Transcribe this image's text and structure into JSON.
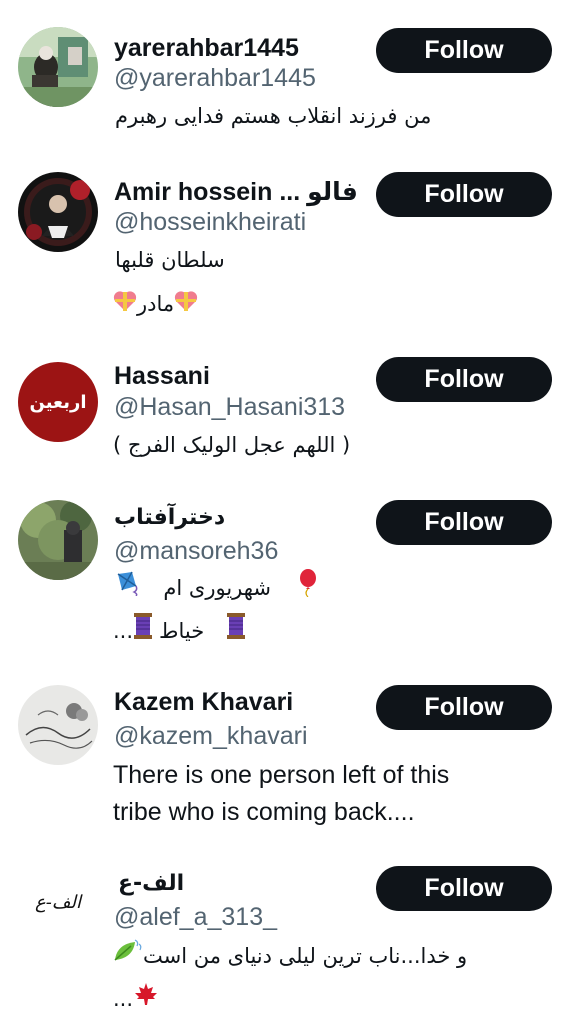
{
  "follow_label": "Follow",
  "users": [
    {
      "name": "yarerahbar1445",
      "handle": "@yarerahbar1445",
      "bio_lines": [
        "من فرزند انقلاب هستم فدایی رهبرم"
      ]
    },
    {
      "name": "Amir hossein ... فالو",
      "handle": "@hosseinkheirati",
      "bio_lines": [
        "سلطان قلبها",
        "مادر"
      ]
    },
    {
      "name": "Hassani",
      "handle": "@Hasan_Hasani313",
      "bio_lines": [
        "( اللهم عجل الولیک الفرج )"
      ]
    },
    {
      "name": "دخترآفتاب",
      "handle": "@mansoreh36",
      "bio_lines": [
        "شهریوری ام",
        "خیاط",
        "..."
      ]
    },
    {
      "name": "Kazem Khavari",
      "handle": "@kazem_khavari",
      "bio_lines": [
        "There is one person left of this",
        "tribe who is coming back...."
      ]
    },
    {
      "name": "الف-ع",
      "handle": "@alef_a_313_",
      "bio_lines": [
        "و خدا...ناب ترین لیلی دنیای من است",
        "..."
      ]
    }
  ],
  "avatars": {
    "user6_text": "الف-ع",
    "user3_text": "اربعین"
  },
  "colors": {
    "follow_bg": "#0f1419",
    "follow_text": "#ffffff",
    "handle": "#536471",
    "text": "#0f1419"
  }
}
